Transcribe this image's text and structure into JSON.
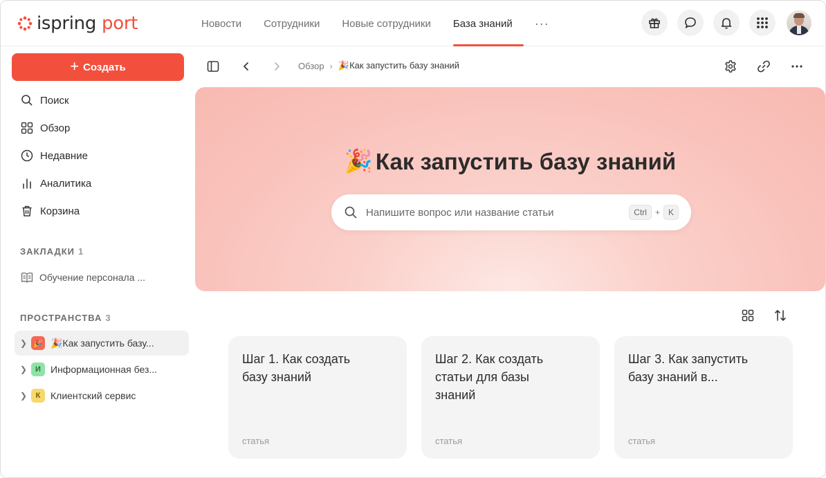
{
  "brand": {
    "word1": "ispring",
    "word2": "port",
    "accent": "#f2503d"
  },
  "topnav": {
    "tabs": [
      {
        "label": "Новости"
      },
      {
        "label": "Сотрудники"
      },
      {
        "label": "Новые сотрудники"
      },
      {
        "label": "База знаний",
        "active": true
      }
    ],
    "more": "···"
  },
  "top_actions": [
    "gift-icon",
    "chat-icon",
    "bell-icon",
    "apps-grid-icon",
    "avatar"
  ],
  "sidebar": {
    "create_label": "Создать",
    "items": [
      {
        "label": "Поиск",
        "icon": "search-icon"
      },
      {
        "label": "Обзор",
        "icon": "overview-grid-icon"
      },
      {
        "label": "Недавние",
        "icon": "clock-icon"
      },
      {
        "label": "Аналитика",
        "icon": "analytics-icon"
      },
      {
        "label": "Корзина",
        "icon": "trash-icon"
      }
    ],
    "bookmarks": {
      "title": "ЗАКЛАДКИ",
      "count": "1",
      "items": [
        {
          "label": "Обучение персонала ...",
          "icon": "book-icon"
        }
      ]
    },
    "spaces": {
      "title": "ПРОСТРАНСТВА",
      "count": "3",
      "items": [
        {
          "label": "🎉Как запустить базу...",
          "badge": "🎉",
          "badge_bg": "#f26a55",
          "active": true
        },
        {
          "label": "Информационная без...",
          "badge": "И",
          "badge_bg": "#8fe3a8"
        },
        {
          "label": "Клиентский сервис",
          "badge": "К",
          "badge_bg": "#f7d86c"
        }
      ]
    }
  },
  "breadcrumb": {
    "items": [
      "Обзор"
    ],
    "current": "🎉Как запустить базу знаний"
  },
  "hero": {
    "emoji": "🎉",
    "title": "Как запустить базу знаний",
    "search_placeholder": "Напишите вопрос или название статьи",
    "shortcut_key1": "Ctrl",
    "shortcut_plus": "+",
    "shortcut_key2": "K"
  },
  "cards": [
    {
      "title": "Шаг 1. Как создать базу знаний",
      "type": "статья"
    },
    {
      "title": "Шаг 2. Как создать статьи для базы знаний",
      "type": "статья"
    },
    {
      "title": "Шаг 3. Как запустить базу знаний в...",
      "type": "статья"
    }
  ]
}
